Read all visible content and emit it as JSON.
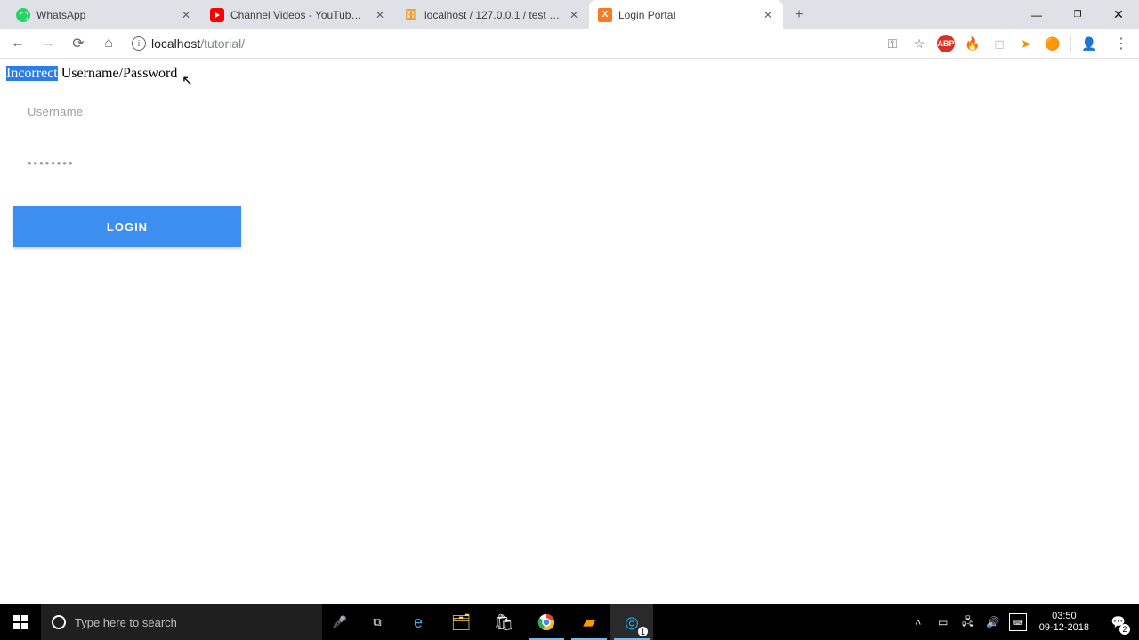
{
  "tabs": [
    {
      "title": "WhatsApp"
    },
    {
      "title": "Channel Videos - YouTube Studio"
    },
    {
      "title": "localhost / 127.0.0.1 / test / users"
    },
    {
      "title": "Login Portal"
    }
  ],
  "address": {
    "host": "localhost",
    "path": "/tutorial/"
  },
  "page": {
    "error_highlight": "Incorrect",
    "error_rest": " Username/Password",
    "username_placeholder": "Username",
    "password_placeholder": "••••••••",
    "login_label": "LOGIN"
  },
  "taskbar": {
    "search_placeholder": "Type here to search",
    "time": "03:50",
    "date": "09-12-2018",
    "notif_count": "2"
  }
}
